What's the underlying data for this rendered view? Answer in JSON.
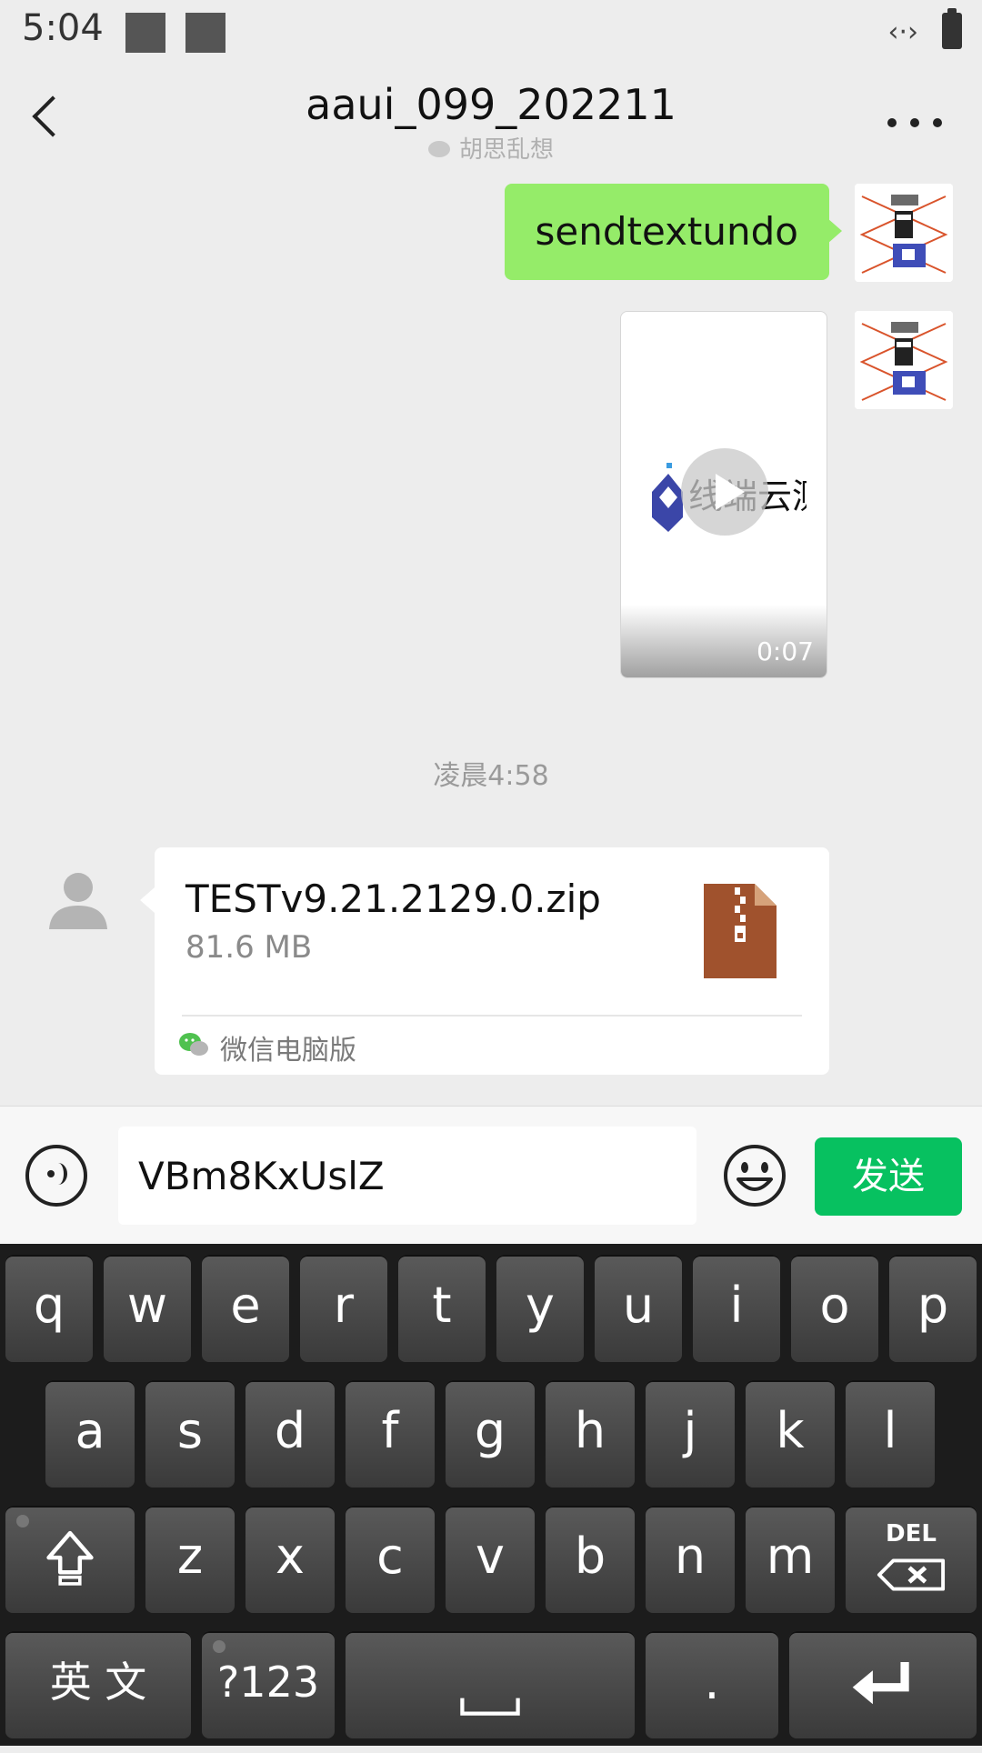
{
  "status_bar": {
    "time": "5:04",
    "link_icon": "‹·›"
  },
  "header": {
    "title": "aaui_099_202211",
    "subtitle": "胡思乱想",
    "back_icon": "back-chevron-icon",
    "more_icon": "more-icon"
  },
  "messages": {
    "sent_text": "sendtextundo",
    "video": {
      "duration": "0:07",
      "logo_text": "线端云测"
    },
    "timestamp": "凌晨4:58",
    "file": {
      "name": "TESTv9.21.2129.0.zip",
      "size": "81.6 MB",
      "source": "微信电脑版"
    }
  },
  "input_bar": {
    "input_value": "VBm8KxUslZ",
    "send_label": "发送"
  },
  "keyboard": {
    "row1": [
      "q",
      "w",
      "e",
      "r",
      "t",
      "y",
      "u",
      "i",
      "o",
      "p"
    ],
    "row2": [
      "a",
      "s",
      "d",
      "f",
      "g",
      "h",
      "j",
      "k",
      "l"
    ],
    "row3": [
      "z",
      "x",
      "c",
      "v",
      "b",
      "n",
      "m"
    ],
    "del_label": "DEL",
    "lang_label": "英 文",
    "num_label": "?123",
    "period_label": "."
  },
  "colors": {
    "bubble_green": "#95ec69",
    "send_green": "#07c160",
    "background": "#ededed"
  }
}
